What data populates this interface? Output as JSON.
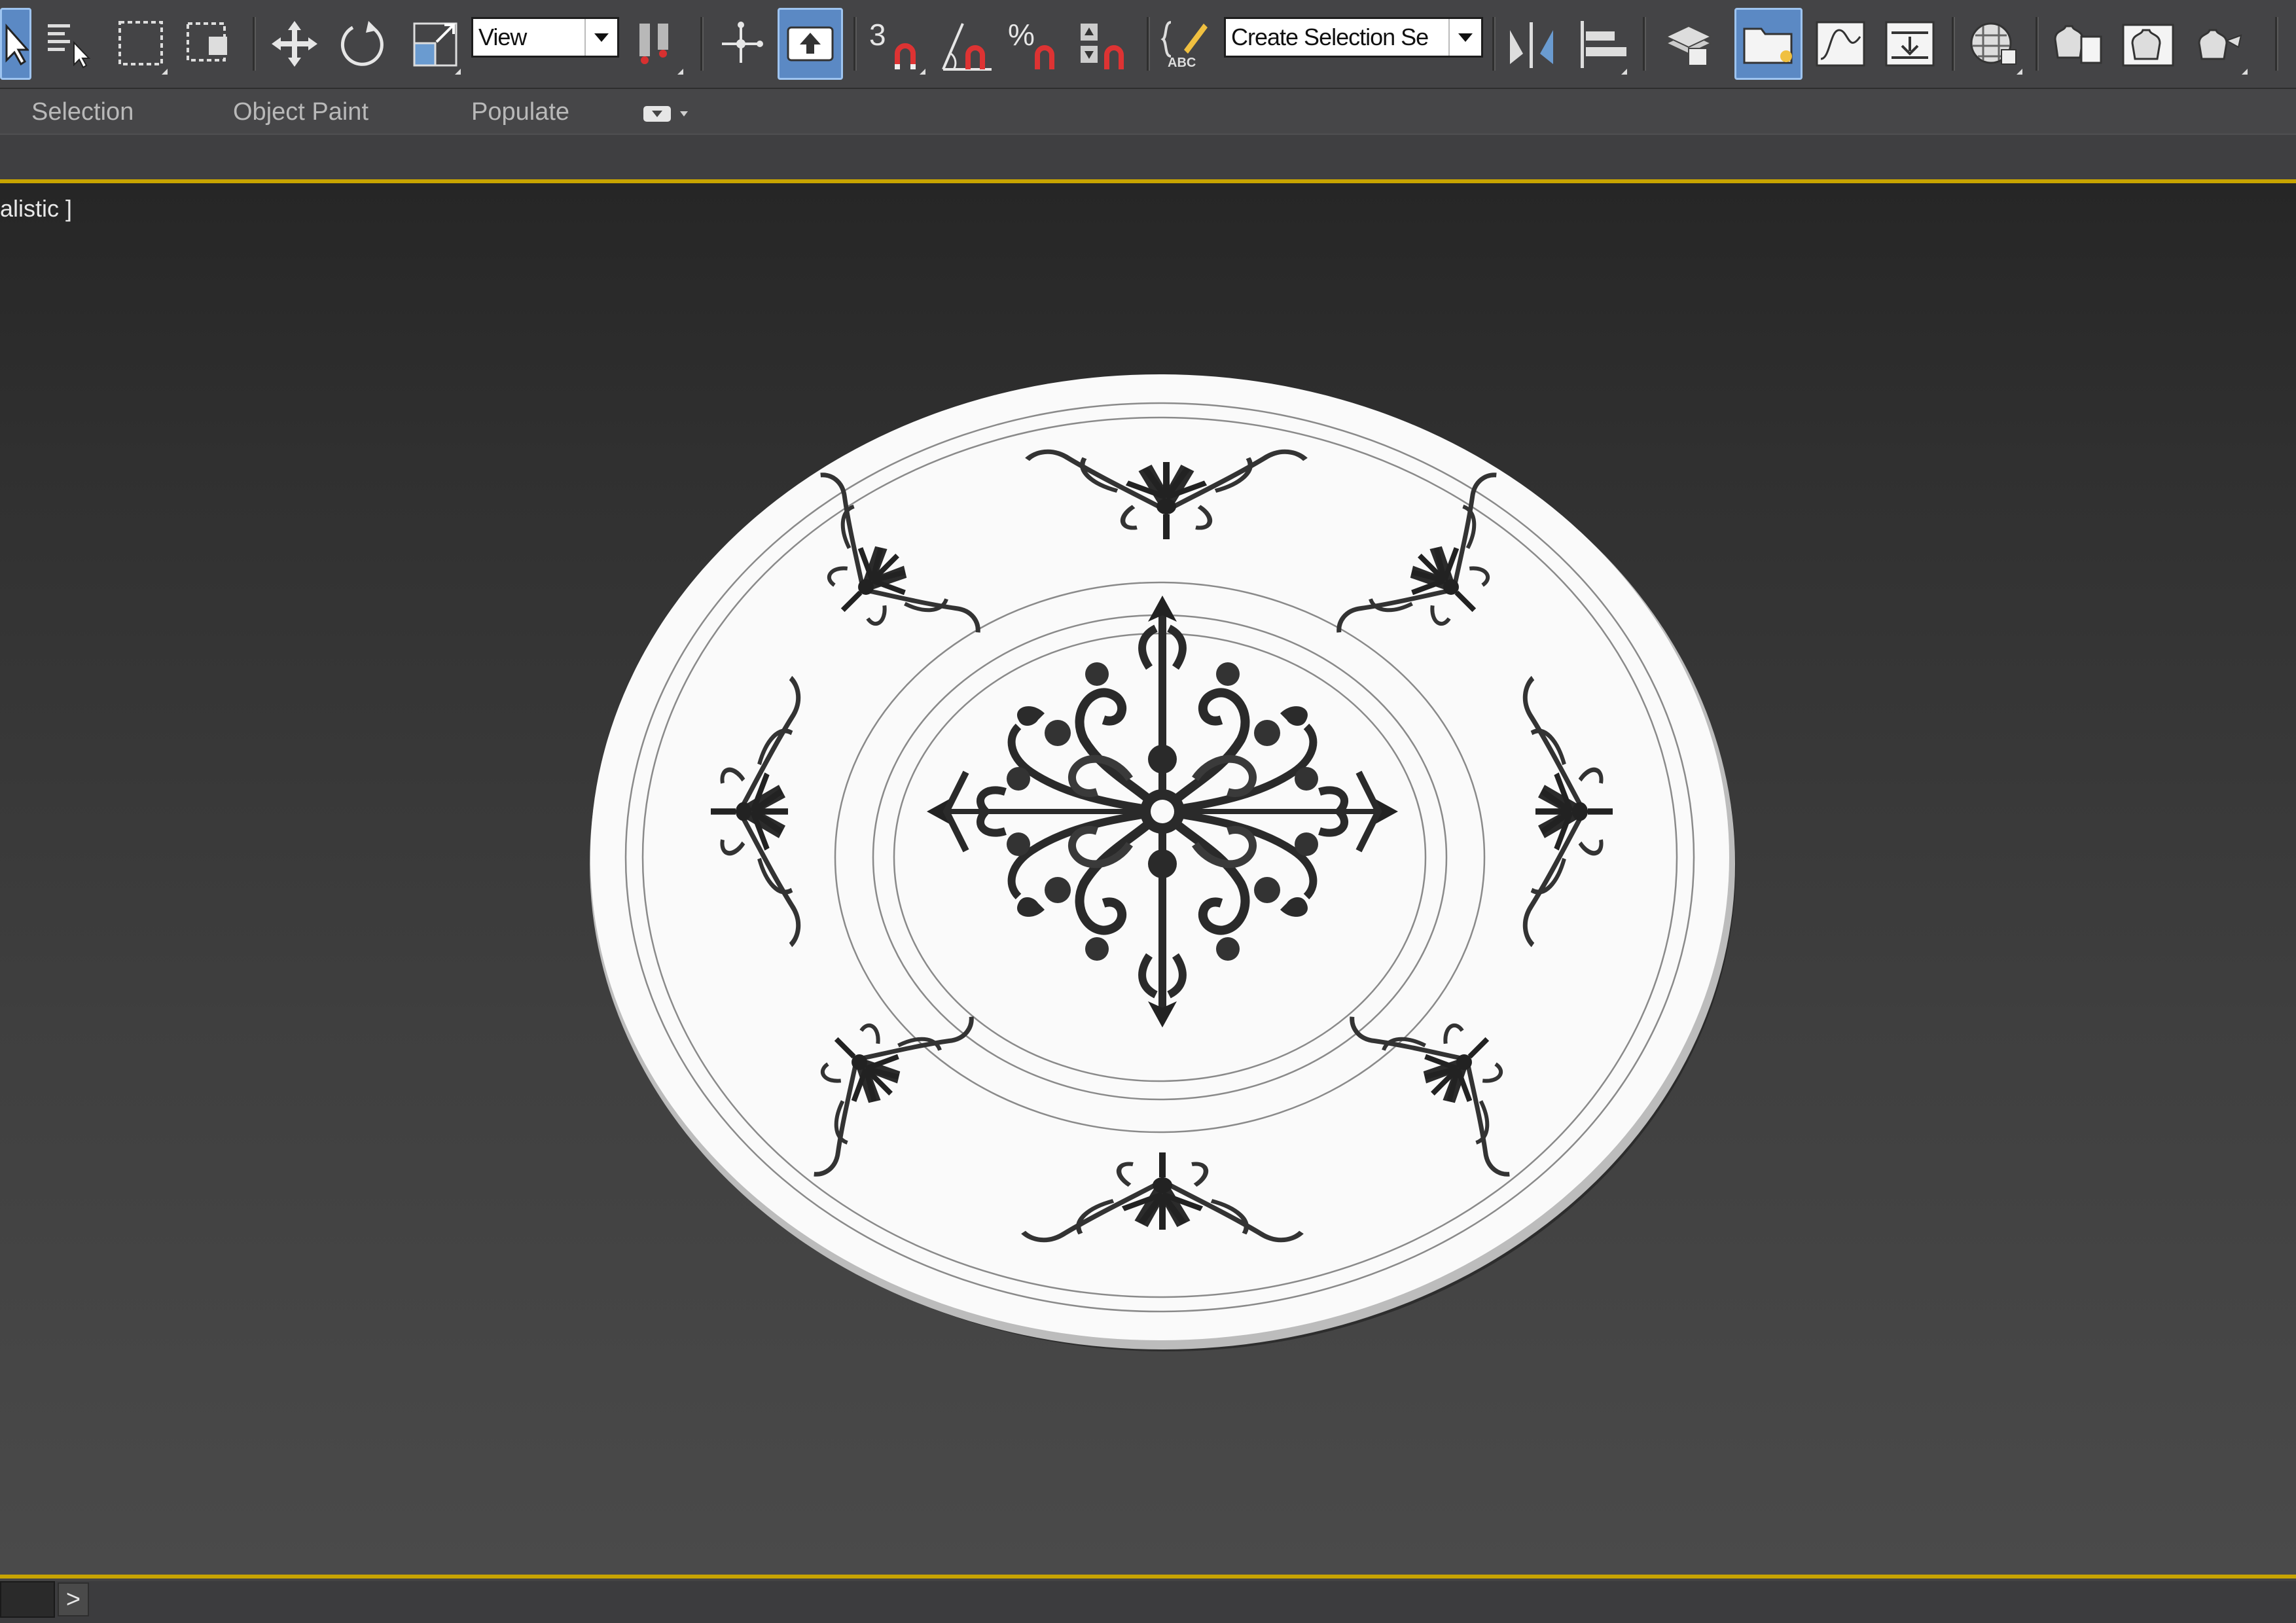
{
  "toolbar": {
    "reference_coord_system": "View",
    "named_selection_placeholder": "Create Selection Se",
    "snap_toggle_label": "3",
    "percent_snap_label": "%",
    "edit_named_sets_label": "ABC",
    "icons": [
      "select-object-icon",
      "select-by-name-icon",
      "rectangular-selection-region-icon",
      "window-crossing-icon",
      "select-and-move-icon",
      "select-and-rotate-icon",
      "select-and-scale-icon",
      "select-and-link-icon",
      "use-pivot-point-icon",
      "select-and-manipulate-icon",
      "snaps-toggle-icon",
      "angle-snap-icon",
      "percent-snap-icon",
      "spinner-snap-icon",
      "edit-named-selection-sets-icon",
      "mirror-icon",
      "align-icon",
      "layer-explorer-icon",
      "scene-explorer-icon",
      "curve-editor-icon",
      "schematic-view-icon",
      "material-editor-icon",
      "render-setup-icon",
      "rendered-frame-window-icon",
      "render-production-icon"
    ],
    "accent_color": "#5b89c4"
  },
  "ribbon": {
    "tabs": [
      "Selection",
      "Object Paint",
      "Populate"
    ]
  },
  "viewport": {
    "label": "alistic ]",
    "border_color": "#c8a400"
  },
  "bottom_bar": {
    "arrow_label": ">"
  }
}
